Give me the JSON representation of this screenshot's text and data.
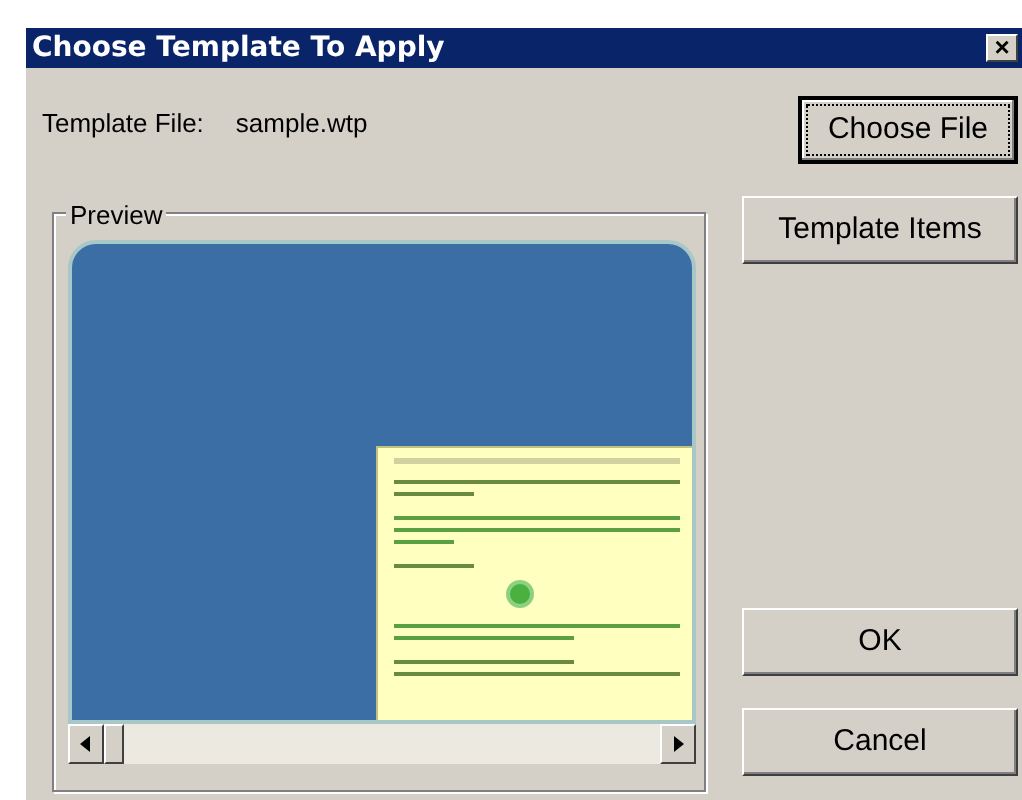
{
  "window": {
    "title": "Choose Template To Apply",
    "close": "×"
  },
  "template_file": {
    "label": "Template File:",
    "value": "sample.wtp"
  },
  "preview": {
    "label": "Preview"
  },
  "side_buttons": [
    {
      "label": "Choose File",
      "focused": true
    },
    {
      "label": "Template Items",
      "focused": false
    }
  ],
  "dialog_buttons": [
    {
      "label": "OK",
      "focused": false
    },
    {
      "label": "Cancel",
      "focused": false
    }
  ]
}
